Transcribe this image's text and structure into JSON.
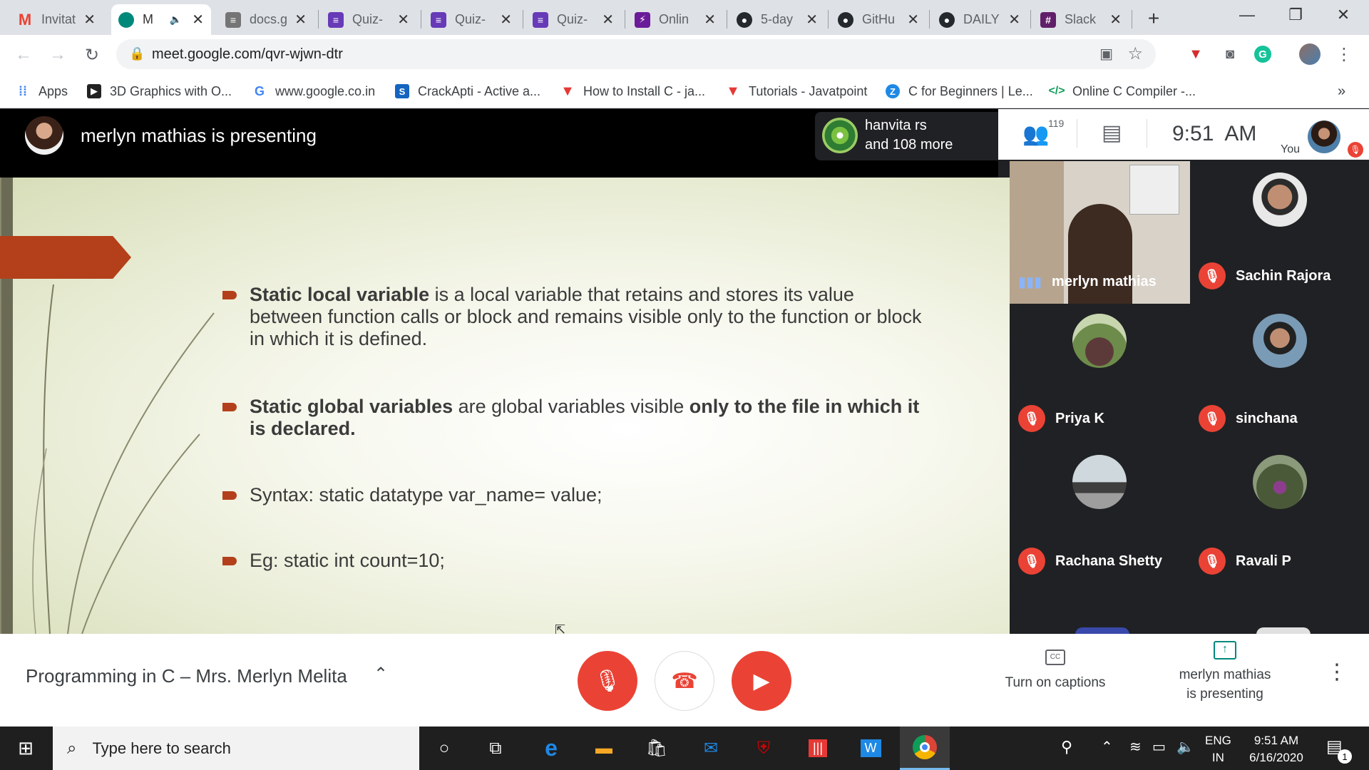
{
  "browser": {
    "tabs": [
      {
        "title": "Invitat",
        "favicon": "gmail-icon",
        "color": "#ea4335",
        "glyph": "M"
      },
      {
        "title": "M",
        "favicon": "meet-icon",
        "color": "#00897b",
        "glyph": "◉",
        "active": true
      },
      {
        "title": "docs.g",
        "favicon": "docs-icon",
        "color": "#757575",
        "glyph": "≡"
      },
      {
        "title": "Quiz-",
        "favicon": "forms-icon",
        "color": "#673ab7",
        "glyph": "≡"
      },
      {
        "title": "Quiz-",
        "favicon": "forms-icon",
        "color": "#673ab7",
        "glyph": "≡"
      },
      {
        "title": "Quiz-",
        "favicon": "forms-icon",
        "color": "#673ab7",
        "glyph": "≡"
      },
      {
        "title": "Onlin",
        "favicon": "compiler-icon",
        "color": "#6a1b9a",
        "glyph": "⚡"
      },
      {
        "title": "5-day",
        "favicon": "github-icon",
        "color": "#24292e",
        "glyph": "●"
      },
      {
        "title": "GitHu",
        "favicon": "github-icon",
        "color": "#24292e",
        "glyph": "●"
      },
      {
        "title": "DAILY",
        "favicon": "github-icon",
        "color": "#24292e",
        "glyph": "●"
      },
      {
        "title": "Slack",
        "favicon": "slack-icon",
        "color": "#611f69",
        "glyph": "#"
      }
    ],
    "new_tab": "+",
    "url": "meet.google.com/qvr-wjwn-dtr",
    "bookmarks": [
      {
        "label": "Apps",
        "color": "#4285f4",
        "glyph": "⋮"
      },
      {
        "label": "3D Graphics with O...",
        "color": "#222",
        "glyph": "▶"
      },
      {
        "label": "www.google.co.in",
        "color": "#fff",
        "glyph": "G"
      },
      {
        "label": "CrackApti - Active a...",
        "color": "#1565c0",
        "glyph": "S"
      },
      {
        "label": "How to Install C - ja...",
        "color": "#e53935",
        "glyph": "▼"
      },
      {
        "label": "Tutorials - Javatpoint",
        "color": "#e53935",
        "glyph": "▼"
      },
      {
        "label": "C for Beginners | Le...",
        "color": "#1e88e5",
        "glyph": "Z"
      },
      {
        "label": "Online C Compiler -...",
        "color": "#fff",
        "glyph": "</>"
      }
    ],
    "more_bookmarks": "»"
  },
  "meet": {
    "presenter_banner": "merlyn mathias is presenting",
    "speaker_line1": "hanvita rs",
    "speaker_line2": "and 108 more",
    "participant_count": "119",
    "time": "9:51  AM",
    "you_label": "You",
    "slide": {
      "b1_bold": "Static local variable",
      "b1_rest": " is a local variable that retains and stores its value between function calls or block and remains visible only to the function or block in which it is defined.",
      "b2_bold": "Static global variables",
      "b2_mid": " are global variables visible ",
      "b2_bold2": "only to the file in which it is declared.",
      "b3": "Syntax:  static datatype var_name= value;",
      "b4": "Eg: static int count=10;"
    },
    "participants": [
      {
        "name": "merlyn mathias",
        "speaking": true
      },
      {
        "name": "Sachin Rajora"
      },
      {
        "name": "Priya K"
      },
      {
        "name": "sinchana"
      },
      {
        "name": "Rachana Shetty"
      },
      {
        "name": "Ravali P"
      }
    ],
    "meeting_title": "Programming in C – Mrs. Merlyn Melita",
    "captions_label": "Turn on captions",
    "presenting_line1": "merlyn mathias",
    "presenting_line2": "is presenting"
  },
  "taskbar": {
    "search_placeholder": "Type here to search",
    "lang1": "ENG",
    "lang2": "IN",
    "clock_time": "9:51 AM",
    "clock_date": "6/16/2020",
    "notif_count": "1"
  }
}
